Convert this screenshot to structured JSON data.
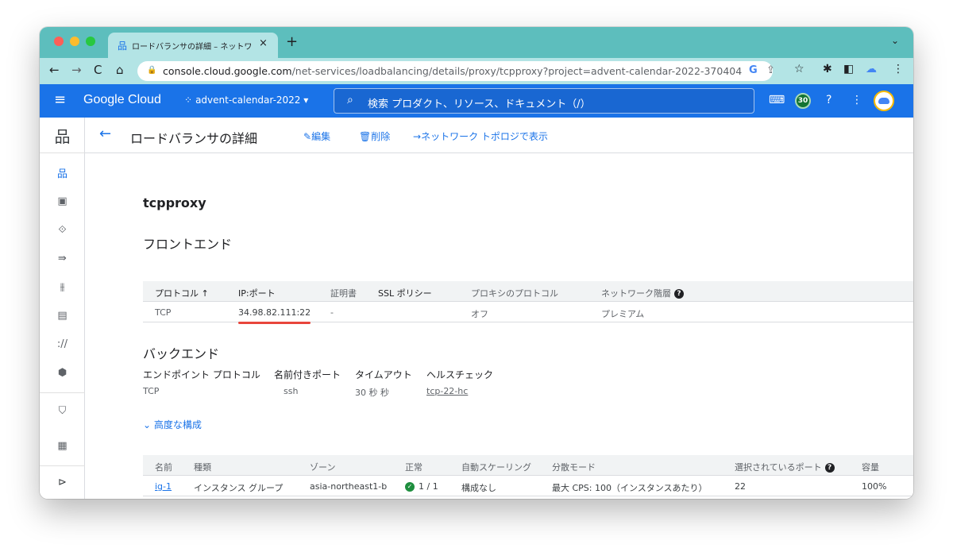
{
  "browser": {
    "tab_title": "ロードバランサの詳細 – ネットワーク",
    "url_host": "console.cloud.google.com",
    "url_path": "/net-services/loadbalancing/details/proxy/tcpproxy?project=advent-calendar-2022-370404&h..."
  },
  "header": {
    "logo": "Google Cloud",
    "project": "advent-calendar-2022",
    "search_placeholder": "検索  プロダクト、リソース、ドキュメント（/）",
    "notification_count": "30"
  },
  "action_bar": {
    "title": "ロードバランサの詳細",
    "edit": "編集",
    "delete": "削除",
    "topology": "ネットワーク トポロジで表示"
  },
  "lb_name": "tcpproxy",
  "frontend": {
    "heading": "フロントエンド",
    "columns": [
      "プロトコル",
      "IP:ポート",
      "証明書",
      "SSL ポリシー",
      "プロキシのプロトコル",
      "ネットワーク階層"
    ],
    "row": {
      "protocol": "TCP",
      "ip_port": "34.98.82.111:22",
      "cert": "-",
      "proxy_protocol": "オフ",
      "tier": "プレミアム"
    }
  },
  "backend": {
    "heading": "バックエンド",
    "labels": [
      "エンドポイント プロトコル",
      "名前付きポート",
      "タイムアウト",
      "ヘルスチェック"
    ],
    "values": {
      "protocol": "TCP",
      "named_port": "ssh",
      "timeout": "30 秒 秒",
      "health_check": "tcp-22-hc"
    },
    "advanced": "高度な構成"
  },
  "backends_table": {
    "columns": [
      "名前",
      "種類",
      "ゾーン",
      "正常",
      "自動スケーリング",
      "分散モード",
      "選択されているポート",
      "容量"
    ],
    "rows": [
      {
        "name": "ig-1",
        "type": "インスタンス グループ",
        "zone": "asia-northeast1-b",
        "healthy": "1 / 1",
        "autoscaling": "構成なし",
        "balancing": "最大 CPS: 100（インスタンスあたり）",
        "port": "22",
        "capacity": "100%"
      }
    ]
  },
  "colors": {
    "primary": "#1a73e8",
    "tab_strip": "#5dbebd",
    "toolbar": "#b3e4e5",
    "healthy_green": "#1e8e3e",
    "link_purple": "#681da8"
  }
}
